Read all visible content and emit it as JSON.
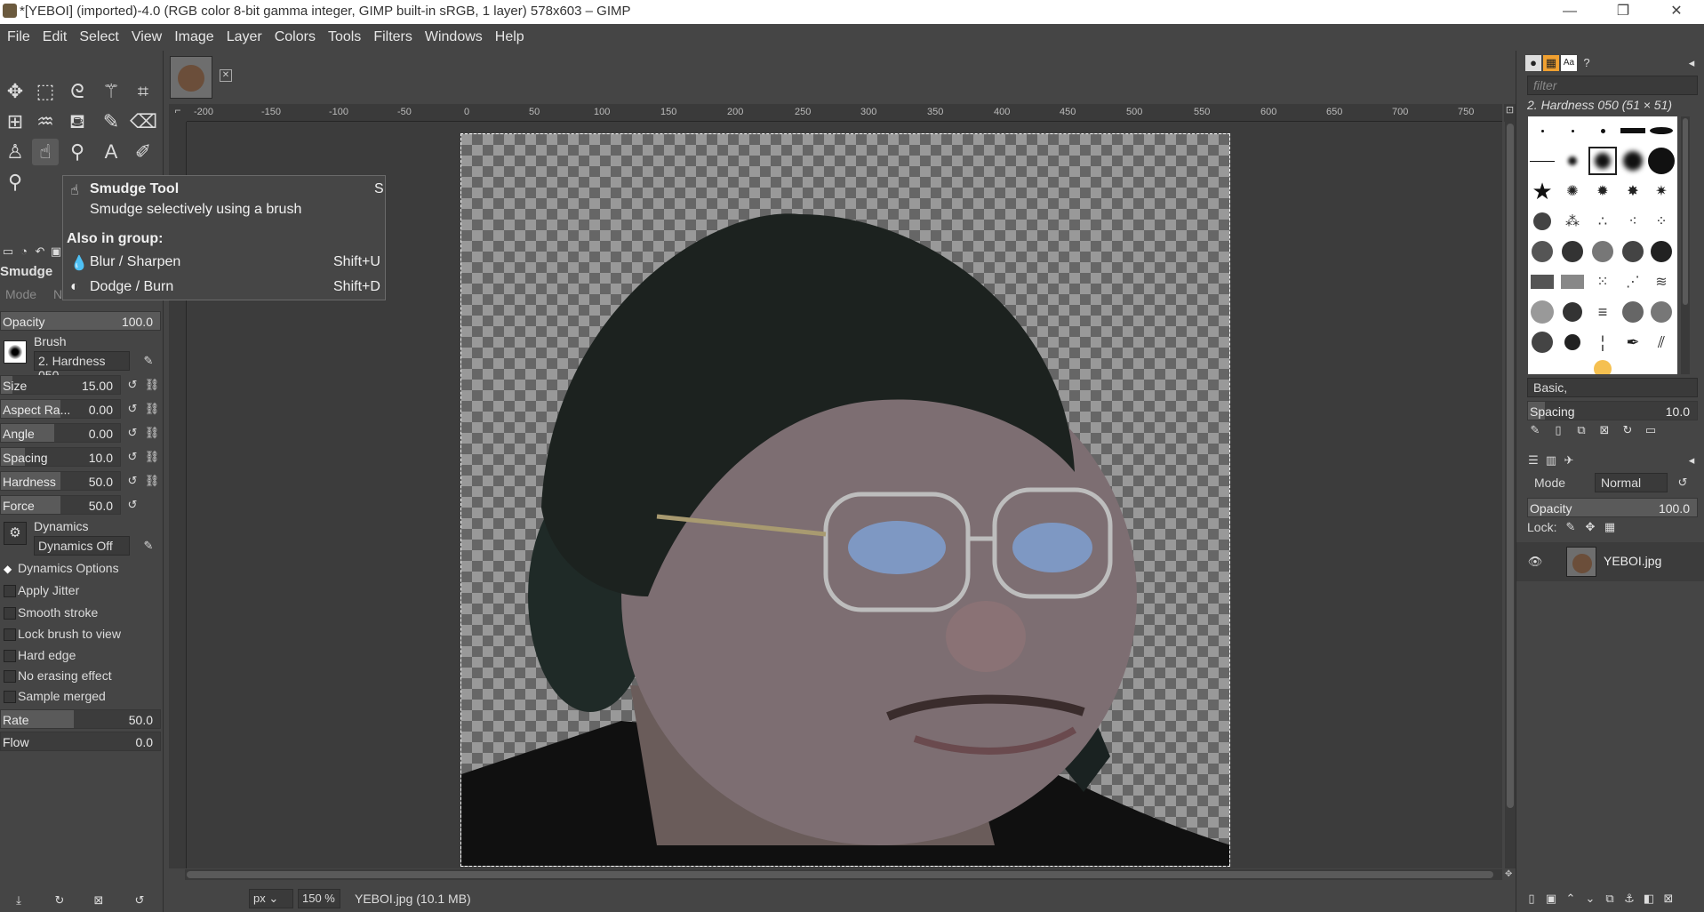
{
  "window": {
    "title": "*[YEBOI] (imported)-4.0 (RGB color 8-bit gamma integer, GIMP built-in sRGB, 1 layer) 578x603 – GIMP",
    "controls": [
      "—",
      "❐",
      "✕"
    ]
  },
  "menu": [
    "File",
    "Edit",
    "Select",
    "View",
    "Image",
    "Layer",
    "Colors",
    "Tools",
    "Filters",
    "Windows",
    "Help"
  ],
  "toolbox": {
    "tools": [
      "move-icon",
      "rect-select-icon",
      "lasso-icon",
      "fuzzy-select-icon",
      "crop-icon",
      "transform-icon",
      "warp-icon",
      "bucket-fill-icon",
      "paintbrush-icon",
      "eraser-icon",
      "clone-icon",
      "smudge-icon",
      "paths-icon",
      "text-icon",
      "color-picker-icon",
      "zoom-icon"
    ],
    "text_tool_glyph": "A"
  },
  "tool_options": {
    "title": "Smudge",
    "mode_label": "Mode",
    "mode_value": "N",
    "opacity": {
      "label": "Opacity",
      "value": "100.0"
    },
    "brush_label": "Brush",
    "brush_value": "2. Hardness 050",
    "size": {
      "label": "Size",
      "value": "15.00"
    },
    "aspect": {
      "label": "Aspect Ra...",
      "value": "0.00"
    },
    "angle": {
      "label": "Angle",
      "value": "0.00"
    },
    "spacing": {
      "label": "Spacing",
      "value": "10.0"
    },
    "hardness": {
      "label": "Hardness",
      "value": "50.0"
    },
    "force": {
      "label": "Force",
      "value": "50.0"
    },
    "dynamics_label": "Dynamics",
    "dynamics_value": "Dynamics Off",
    "dynamics_options": "Dynamics Options",
    "checks": [
      "Apply Jitter",
      "Smooth stroke",
      "Lock brush to view",
      "Hard edge",
      "No erasing effect",
      "Sample merged"
    ],
    "rate": {
      "label": "Rate",
      "value": "50.0"
    },
    "flow": {
      "label": "Flow",
      "value": "0.0"
    }
  },
  "tooltip": {
    "title": "Smudge Tool",
    "shortcut": "S",
    "description": "Smudge selectively using a brush",
    "group_heading": "Also in group:",
    "items": [
      {
        "label": "Blur / Sharpen",
        "shortcut": "Shift+U"
      },
      {
        "label": "Dodge / Burn",
        "shortcut": "Shift+D"
      }
    ]
  },
  "ruler": {
    "h_ticks": [
      "-200",
      "-150",
      "-100",
      "-50",
      "0",
      "50",
      "100",
      "150",
      "200",
      "250",
      "300",
      "350",
      "400",
      "450",
      "500",
      "550",
      "600",
      "650",
      "700",
      "750"
    ]
  },
  "statusbar": {
    "unit": "px",
    "zoom": "150 %",
    "info": "YEBOI.jpg (10.1 MB)"
  },
  "brushes_panel": {
    "filter_placeholder": "filter",
    "selected_brush": "2. Hardness 050 (51 × 51)",
    "preset": "Basic,",
    "spacing": {
      "label": "Spacing",
      "value": "10.0"
    }
  },
  "layers_panel": {
    "mode_label": "Mode",
    "mode_value": "Normal",
    "opacity": {
      "label": "Opacity",
      "value": "100.0"
    },
    "lock_label": "Lock:",
    "layer_name": "YEBOI.jpg"
  }
}
